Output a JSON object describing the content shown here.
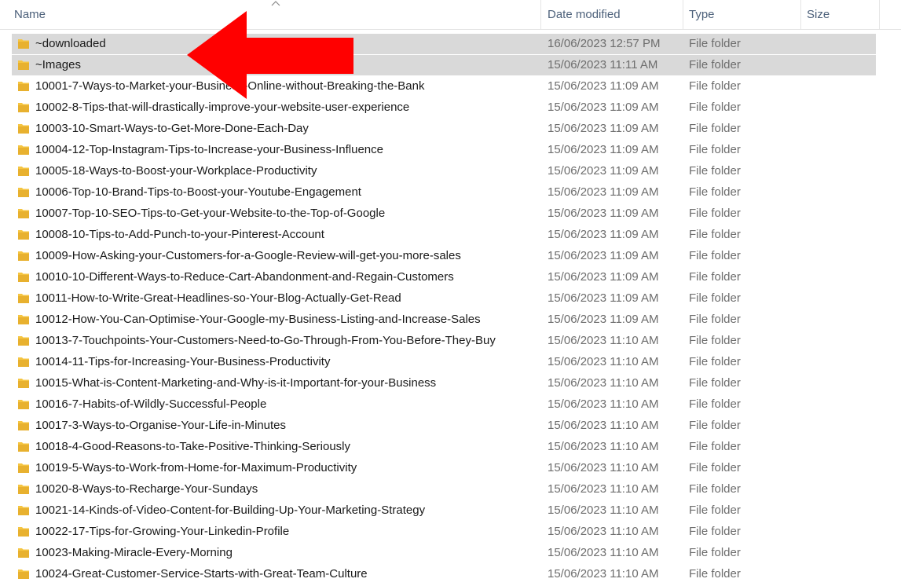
{
  "columns": {
    "name": "Name",
    "date_modified": "Date modified",
    "type": "Type",
    "size": "Size"
  },
  "colors": {
    "folder": "#f5c542",
    "selected_row": "#d9d9d9",
    "arrow": "#ff0000"
  },
  "files": [
    {
      "name": "~downloaded",
      "date": "16/06/2023 12:57 PM",
      "type": "File folder",
      "selected": true
    },
    {
      "name": "~Images",
      "date": "15/06/2023 11:11 AM",
      "type": "File folder",
      "selected": true
    },
    {
      "name": "10001-7-Ways-to-Market-your-Business-Online-without-Breaking-the-Bank",
      "date": "15/06/2023 11:09 AM",
      "type": "File folder"
    },
    {
      "name": "10002-8-Tips-that-will-drastically-improve-your-website-user-experience",
      "date": "15/06/2023 11:09 AM",
      "type": "File folder"
    },
    {
      "name": "10003-10-Smart-Ways-to-Get-More-Done-Each-Day",
      "date": "15/06/2023 11:09 AM",
      "type": "File folder"
    },
    {
      "name": "10004-12-Top-Instagram-Tips-to-Increase-your-Business-Influence",
      "date": "15/06/2023 11:09 AM",
      "type": "File folder"
    },
    {
      "name": "10005-18-Ways-to-Boost-your-Workplace-Productivity",
      "date": "15/06/2023 11:09 AM",
      "type": "File folder"
    },
    {
      "name": "10006-Top-10-Brand-Tips-to-Boost-your-Youtube-Engagement",
      "date": "15/06/2023 11:09 AM",
      "type": "File folder"
    },
    {
      "name": "10007-Top-10-SEO-Tips-to-Get-your-Website-to-the-Top-of-Google",
      "date": "15/06/2023 11:09 AM",
      "type": "File folder"
    },
    {
      "name": "10008-10-Tips-to-Add-Punch-to-your-Pinterest-Account",
      "date": "15/06/2023 11:09 AM",
      "type": "File folder"
    },
    {
      "name": "10009-How-Asking-your-Customers-for-a-Google-Review-will-get-you-more-sales",
      "date": "15/06/2023 11:09 AM",
      "type": "File folder"
    },
    {
      "name": "10010-10-Different-Ways-to-Reduce-Cart-Abandonment-and-Regain-Customers",
      "date": "15/06/2023 11:09 AM",
      "type": "File folder"
    },
    {
      "name": "10011-How-to-Write-Great-Headlines-so-Your-Blog-Actually-Get-Read",
      "date": "15/06/2023 11:09 AM",
      "type": "File folder"
    },
    {
      "name": "10012-How-You-Can-Optimise-Your-Google-my-Business-Listing-and-Increase-Sales",
      "date": "15/06/2023 11:09 AM",
      "type": "File folder"
    },
    {
      "name": "10013-7-Touchpoints-Your-Customers-Need-to-Go-Through-From-You-Before-They-Buy",
      "date": "15/06/2023 11:10 AM",
      "type": "File folder"
    },
    {
      "name": "10014-11-Tips-for-Increasing-Your-Business-Productivity",
      "date": "15/06/2023 11:10 AM",
      "type": "File folder"
    },
    {
      "name": "10015-What-is-Content-Marketing-and-Why-is-it-Important-for-your-Business",
      "date": "15/06/2023 11:10 AM",
      "type": "File folder"
    },
    {
      "name": "10016-7-Habits-of-Wildly-Successful-People",
      "date": "15/06/2023 11:10 AM",
      "type": "File folder"
    },
    {
      "name": "10017-3-Ways-to-Organise-Your-Life-in-Minutes",
      "date": "15/06/2023 11:10 AM",
      "type": "File folder"
    },
    {
      "name": "10018-4-Good-Reasons-to-Take-Positive-Thinking-Seriously",
      "date": "15/06/2023 11:10 AM",
      "type": "File folder"
    },
    {
      "name": "10019-5-Ways-to-Work-from-Home-for-Maximum-Productivity",
      "date": "15/06/2023 11:10 AM",
      "type": "File folder"
    },
    {
      "name": "10020-8-Ways-to-Recharge-Your-Sundays",
      "date": "15/06/2023 11:10 AM",
      "type": "File folder"
    },
    {
      "name": "10021-14-Kinds-of-Video-Content-for-Building-Up-Your-Marketing-Strategy",
      "date": "15/06/2023 11:10 AM",
      "type": "File folder"
    },
    {
      "name": "10022-17-Tips-for-Growing-Your-Linkedin-Profile",
      "date": "15/06/2023 11:10 AM",
      "type": "File folder"
    },
    {
      "name": "10023-Making-Miracle-Every-Morning",
      "date": "15/06/2023 11:10 AM",
      "type": "File folder"
    },
    {
      "name": "10024-Great-Customer-Service-Starts-with-Great-Team-Culture",
      "date": "15/06/2023 11:10 AM",
      "type": "File folder"
    }
  ]
}
